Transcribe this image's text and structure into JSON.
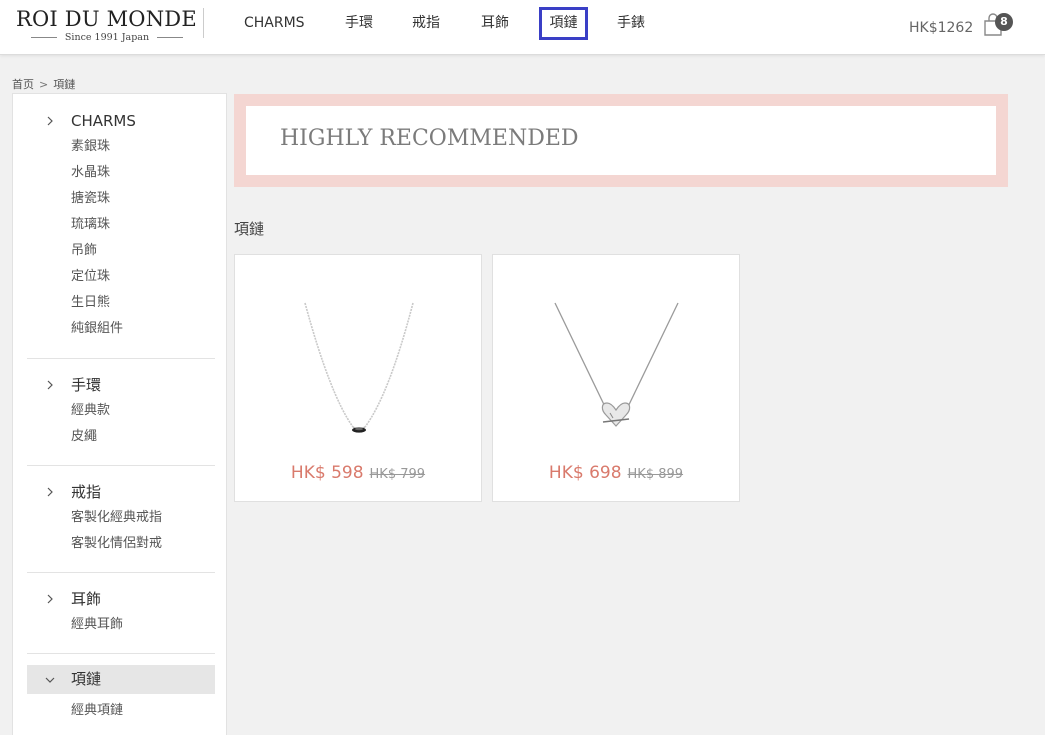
{
  "header": {
    "logo_name": "ROI DU MONDE",
    "logo_tagline": "Since 1991 Japan",
    "nav": [
      {
        "label": "CHARMS"
      },
      {
        "label": "手環"
      },
      {
        "label": "戒指"
      },
      {
        "label": "耳飾"
      },
      {
        "label": "項鏈",
        "active": true
      },
      {
        "label": "手錶"
      }
    ],
    "cart_total": "HK$1262",
    "cart_count": "8",
    "cart_icon": "shopping-bag-icon"
  },
  "breadcrumb": {
    "home": "首页",
    "separator": ">",
    "current": "項鏈"
  },
  "sidebar": {
    "categories": [
      {
        "label": "CHARMS",
        "expanded": false,
        "items": [
          "素銀珠",
          "水晶珠",
          "搪瓷珠",
          "琉璃珠",
          "吊飾",
          "定位珠",
          "生日熊",
          "純銀組件"
        ]
      },
      {
        "label": "手環",
        "expanded": false,
        "items": [
          "經典款",
          "皮繩"
        ]
      },
      {
        "label": "戒指",
        "expanded": false,
        "items": [
          "客製化經典戒指",
          "客製化情侶對戒"
        ]
      },
      {
        "label": "耳飾",
        "expanded": false,
        "items": [
          "經典耳飾"
        ]
      },
      {
        "label": "項鏈",
        "expanded": true,
        "items": [
          "經典項鏈"
        ]
      }
    ]
  },
  "banner": {
    "title": "HIGHLY RECOMMENDED"
  },
  "section": {
    "title": "項鏈"
  },
  "products": [
    {
      "price": "HK$ 598",
      "original_price": "HK$ 799",
      "image": "silver-necklace-bar-pendant"
    },
    {
      "price": "HK$ 698",
      "original_price": "HK$ 899",
      "image": "silver-necklace-heart-pendant"
    }
  ],
  "colors": {
    "accent_border": "#3a3fc6",
    "banner_bg": "#f4d6d2",
    "price": "#d97a6c"
  }
}
